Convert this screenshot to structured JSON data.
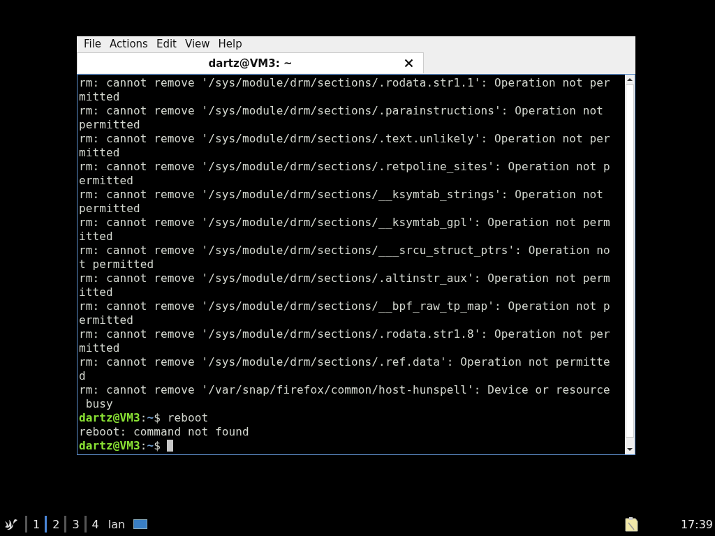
{
  "window": {
    "menu": [
      "File",
      "Actions",
      "Edit",
      "View",
      "Help"
    ],
    "tabs": [
      {
        "title": "dartz@VM3: ~",
        "selected": true
      }
    ],
    "terminal": {
      "lines": [
        {
          "kind": "output",
          "text": "rm: cannot remove '/sys/module/drm/sections/.rodata.str1.1': Operation not per"
        },
        {
          "kind": "output",
          "text": "mitted"
        },
        {
          "kind": "output",
          "text": "rm: cannot remove '/sys/module/drm/sections/.parainstructions': Operation not"
        },
        {
          "kind": "output",
          "text": "permitted"
        },
        {
          "kind": "output",
          "text": "rm: cannot remove '/sys/module/drm/sections/.text.unlikely': Operation not per"
        },
        {
          "kind": "output",
          "text": "mitted"
        },
        {
          "kind": "output",
          "text": "rm: cannot remove '/sys/module/drm/sections/.retpoline_sites': Operation not p"
        },
        {
          "kind": "output",
          "text": "ermitted"
        },
        {
          "kind": "output",
          "text": "rm: cannot remove '/sys/module/drm/sections/__ksymtab_strings': Operation not"
        },
        {
          "kind": "output",
          "text": "permitted"
        },
        {
          "kind": "output",
          "text": "rm: cannot remove '/sys/module/drm/sections/__ksymtab_gpl': Operation not perm"
        },
        {
          "kind": "output",
          "text": "itted"
        },
        {
          "kind": "output",
          "text": "rm: cannot remove '/sys/module/drm/sections/___srcu_struct_ptrs': Operation no"
        },
        {
          "kind": "output",
          "text": "t permitted"
        },
        {
          "kind": "output",
          "text": "rm: cannot remove '/sys/module/drm/sections/.altinstr_aux': Operation not perm"
        },
        {
          "kind": "output",
          "text": "itted"
        },
        {
          "kind": "output",
          "text": "rm: cannot remove '/sys/module/drm/sections/__bpf_raw_tp_map': Operation not p"
        },
        {
          "kind": "output",
          "text": "ermitted"
        },
        {
          "kind": "output",
          "text": "rm: cannot remove '/sys/module/drm/sections/.rodata.str1.8': Operation not per"
        },
        {
          "kind": "output",
          "text": "mitted"
        },
        {
          "kind": "output",
          "text": "rm: cannot remove '/sys/module/drm/sections/.ref.data': Operation not permitte"
        },
        {
          "kind": "output",
          "text": "d"
        },
        {
          "kind": "output",
          "text": "rm: cannot remove '/var/snap/firefox/common/host-hunspell': Device or resource"
        },
        {
          "kind": "output",
          "text": " busy"
        },
        {
          "kind": "prompt",
          "user": "dartz@VM3",
          "sep": ":",
          "path": "~",
          "symbol": "$",
          "command": "reboot"
        },
        {
          "kind": "output",
          "text": "reboot: command not found"
        },
        {
          "kind": "prompt",
          "user": "dartz@VM3",
          "sep": ":",
          "path": "~",
          "symbol": "$",
          "cursor": true
        }
      ]
    }
  },
  "taskbar": {
    "workspaces": [
      {
        "label": "1",
        "selected": false
      },
      {
        "label": "2",
        "selected": true
      },
      {
        "label": "3",
        "selected": false
      },
      {
        "label": "4",
        "selected": false
      }
    ],
    "task": "lan",
    "clock": "17:39"
  }
}
